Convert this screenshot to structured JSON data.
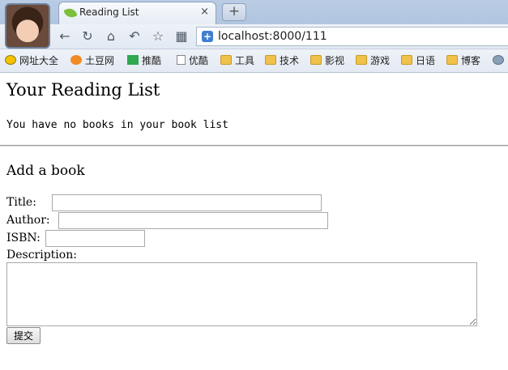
{
  "browser": {
    "tab": {
      "title": "Reading List",
      "close": "×"
    },
    "new_tab": "+",
    "nav": {
      "back": "←",
      "reload": "↻",
      "home": "⌂",
      "undo": "↶",
      "star": "☆",
      "apps": "▦"
    },
    "address": {
      "security": "+",
      "url": "localhost:8000/111"
    },
    "bookmarks": [
      "网址大全",
      "土豆网",
      "推酷",
      "优酷",
      "工具",
      "技术",
      "影视",
      "游戏",
      "日语",
      "博客"
    ]
  },
  "page": {
    "heading": "Your Reading List",
    "empty_message": "You have no books in your book list",
    "form": {
      "heading": "Add a book",
      "title_label": "Title:",
      "title_value": "",
      "author_label": "Author:",
      "author_value": "",
      "isbn_label": "ISBN:",
      "isbn_value": "",
      "description_label": "Description:",
      "description_value": "",
      "submit_label": "提交"
    }
  }
}
